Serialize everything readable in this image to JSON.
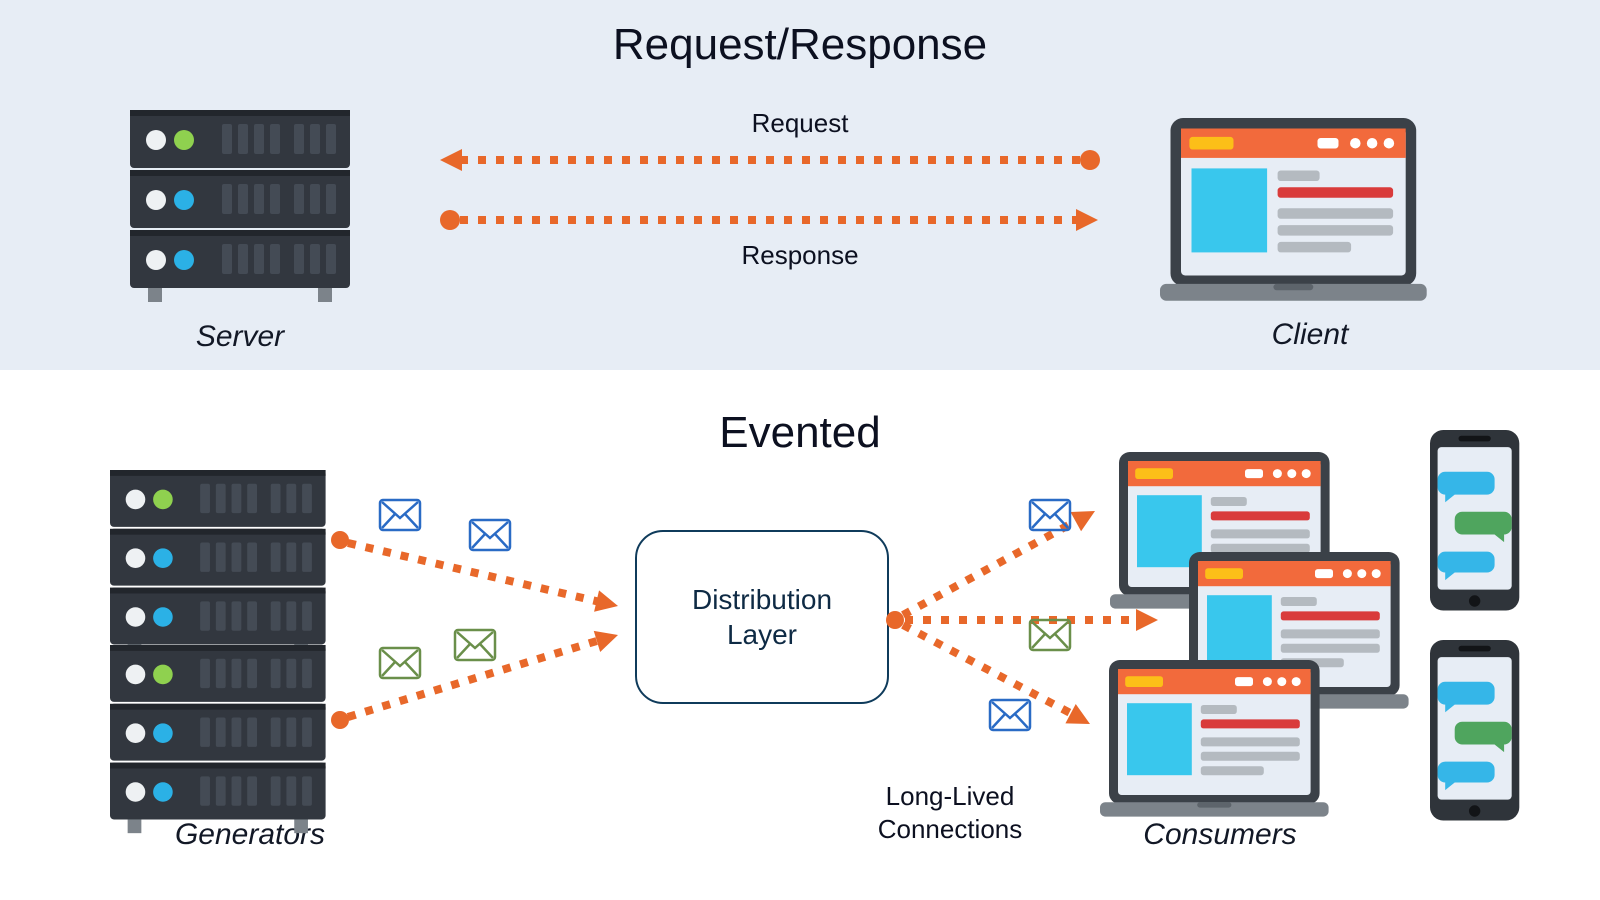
{
  "top": {
    "title": "Request/Response",
    "request_label": "Request",
    "response_label": "Response",
    "server_label": "Server",
    "client_label": "Client"
  },
  "bottom": {
    "title": "Evented",
    "generators_label": "Generators",
    "distribution_label_line1": "Distribution",
    "distribution_label_line2": "Layer",
    "longlived_line1": "Long-Lived",
    "longlived_line2": "Connections",
    "consumers_label": "Consumers"
  },
  "colors": {
    "arrow": "#e8682a",
    "envelope_blue": "#2a6bc5",
    "envelope_green": "#6a8f4a",
    "server_body": "#32373f",
    "server_dark": "#22262c",
    "server_vent": "#444b55",
    "led_white": "#eef1f3",
    "led_green": "#8fd14f",
    "led_blue": "#2bb1e6",
    "laptop_body": "#3b4148",
    "laptop_base": "#7c838a",
    "laptop_screen": "#e7edf5",
    "tab_orange": "#f26a3c",
    "tab_green": "#8fd14f",
    "tab_yellow": "#fcbf18",
    "content_cyan": "#39c7ed",
    "content_red": "#d93b3b",
    "content_grey": "#b4bac0",
    "phone_body": "#2f343a",
    "bubble_blue": "#35b6e8",
    "bubble_green": "#4fa55e",
    "dist_border": "#0f3b5b"
  }
}
